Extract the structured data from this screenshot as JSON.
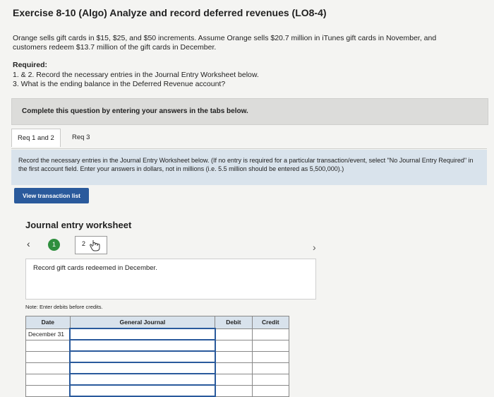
{
  "title": "Exercise 8-10 (Algo) Analyze and record deferred revenues (LO8-4)",
  "intro": "Orange sells gift cards in $15, $25, and $50 increments. Assume Orange sells $20.7 million in iTunes gift cards in November, and customers redeem $13.7 million of the gift cards in December.",
  "required": {
    "heading": "Required:",
    "item1": "1. & 2. Record the necessary entries in the Journal Entry Worksheet below.",
    "item2": "3. What is the ending balance in the Deferred Revenue account?"
  },
  "complete_bar": "Complete this question by entering your answers in the tabs below.",
  "tabs": [
    {
      "label": "Req 1 and 2"
    },
    {
      "label": "Req 3"
    }
  ],
  "instructions": "Record the necessary entries in the Journal Entry Worksheet below. (If no entry is required for a particular transaction/event, select \"No Journal Entry Required\" in the first account field. Enter your answers in dollars, not in millions (i.e. 5.5 million should be entered as 5,500,000).)",
  "view_button": "View transaction list",
  "worksheet": {
    "title": "Journal entry worksheet",
    "steps": [
      "1",
      "2"
    ],
    "record_text": "Record gift cards redeemed in December.",
    "note": "Note: Enter debits before credits."
  },
  "journal": {
    "headers": [
      "Date",
      "General Journal",
      "Debit",
      "Credit"
    ],
    "rows": [
      [
        "December 31",
        "",
        "",
        ""
      ],
      [
        "",
        "",
        "",
        ""
      ],
      [
        "",
        "",
        "",
        ""
      ],
      [
        "",
        "",
        "",
        ""
      ],
      [
        "",
        "",
        "",
        ""
      ],
      [
        "",
        "",
        "",
        ""
      ]
    ]
  },
  "colors": {
    "accent": "#2a5a9c",
    "step_active": "#2f8f3e",
    "instructions_bg": "#d9e3ec"
  }
}
